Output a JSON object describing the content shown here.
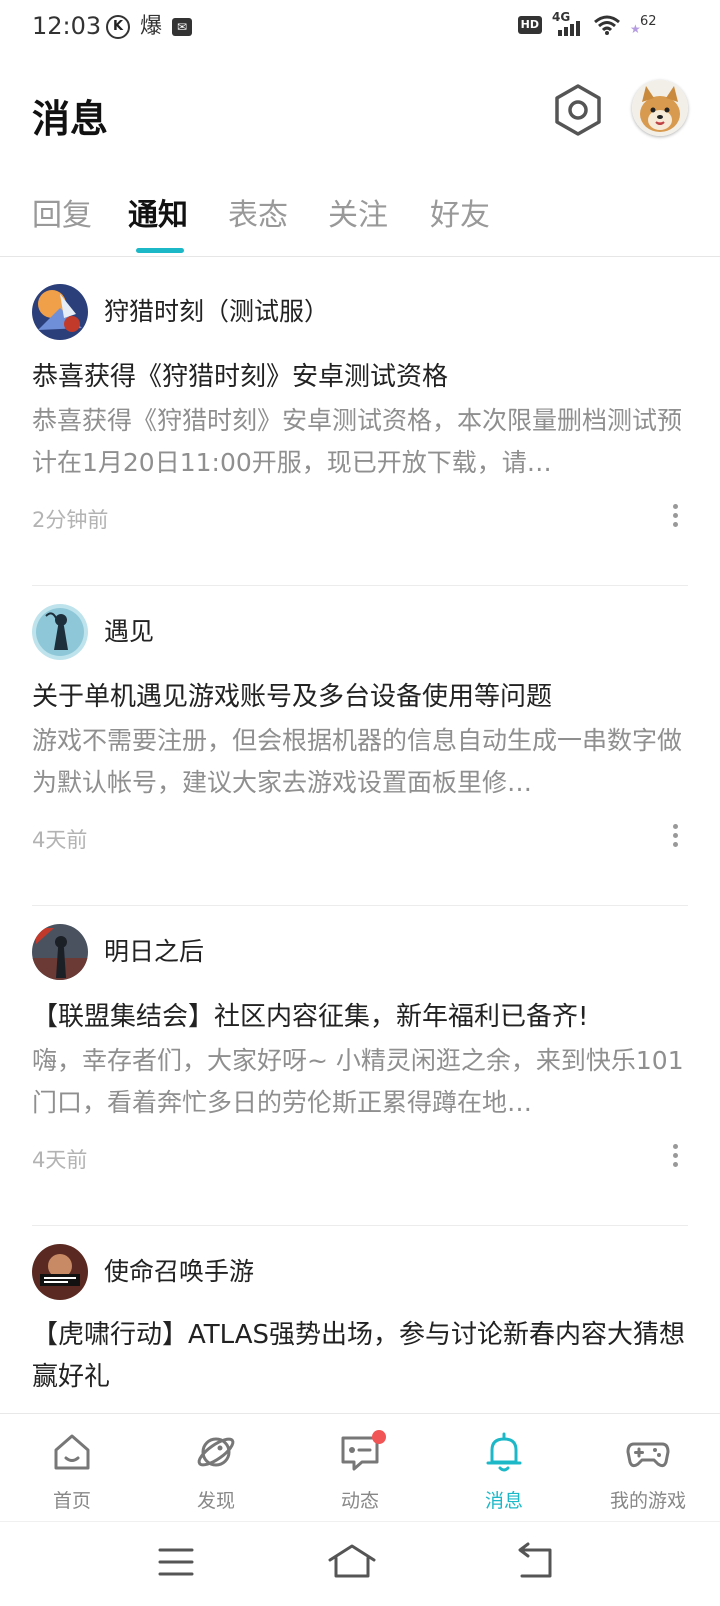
{
  "status_bar": {
    "time": "12:03",
    "left_glyphs": [
      "K",
      "爆"
    ],
    "hd": "HD",
    "network": "4G",
    "battery": "62"
  },
  "header": {
    "title": "消息"
  },
  "tabs": [
    {
      "label": "回复",
      "active": false
    },
    {
      "label": "通知",
      "active": true
    },
    {
      "label": "表态",
      "active": false
    },
    {
      "label": "关注",
      "active": false
    },
    {
      "label": "好友",
      "active": false
    }
  ],
  "notifications": [
    {
      "source": "狩猎时刻（测试服）",
      "title": "恭喜获得《狩猎时刻》安卓测试资格",
      "body": "恭喜获得《狩猎时刻》安卓测试资格，本次限量删档测试预计在1月20日11:00开服，现已开放下载，请…",
      "time": "2分钟前"
    },
    {
      "source": "遇见",
      "title": "关于单机遇见游戏账号及多台设备使用等问题",
      "body": "游戏不需要注册，但会根据机器的信息自动生成一串数字做为默认帐号，建议大家去游戏设置面板里修…",
      "time": "4天前"
    },
    {
      "source": "明日之后",
      "title": "【联盟集结会】社区内容征集，新年福利已备齐!",
      "body": "嗨，幸存者们，大家好呀~ 小精灵闲逛之余，来到快乐101门口，看着奔忙多日的劳伦斯正累得蹲在地…",
      "time": "4天前"
    },
    {
      "source": "使命召唤手游",
      "title": "【虎啸行动】ATLAS强势出场，参与讨论新春内容大猜想赢好礼",
      "body": "",
      "time": ""
    }
  ],
  "bottom_nav": [
    {
      "label": "首页",
      "icon": "home-icon",
      "active": false
    },
    {
      "label": "发现",
      "icon": "discover-planet-icon",
      "active": false
    },
    {
      "label": "动态",
      "icon": "feed-chat-icon",
      "active": false,
      "badge": true
    },
    {
      "label": "消息",
      "icon": "bell-icon",
      "active": true
    },
    {
      "label": "我的游戏",
      "icon": "gamepad-icon",
      "active": false
    }
  ],
  "colors": {
    "accent": "#1db8c8",
    "badge": "#f25555",
    "muted_text": "#8f8f8f"
  }
}
